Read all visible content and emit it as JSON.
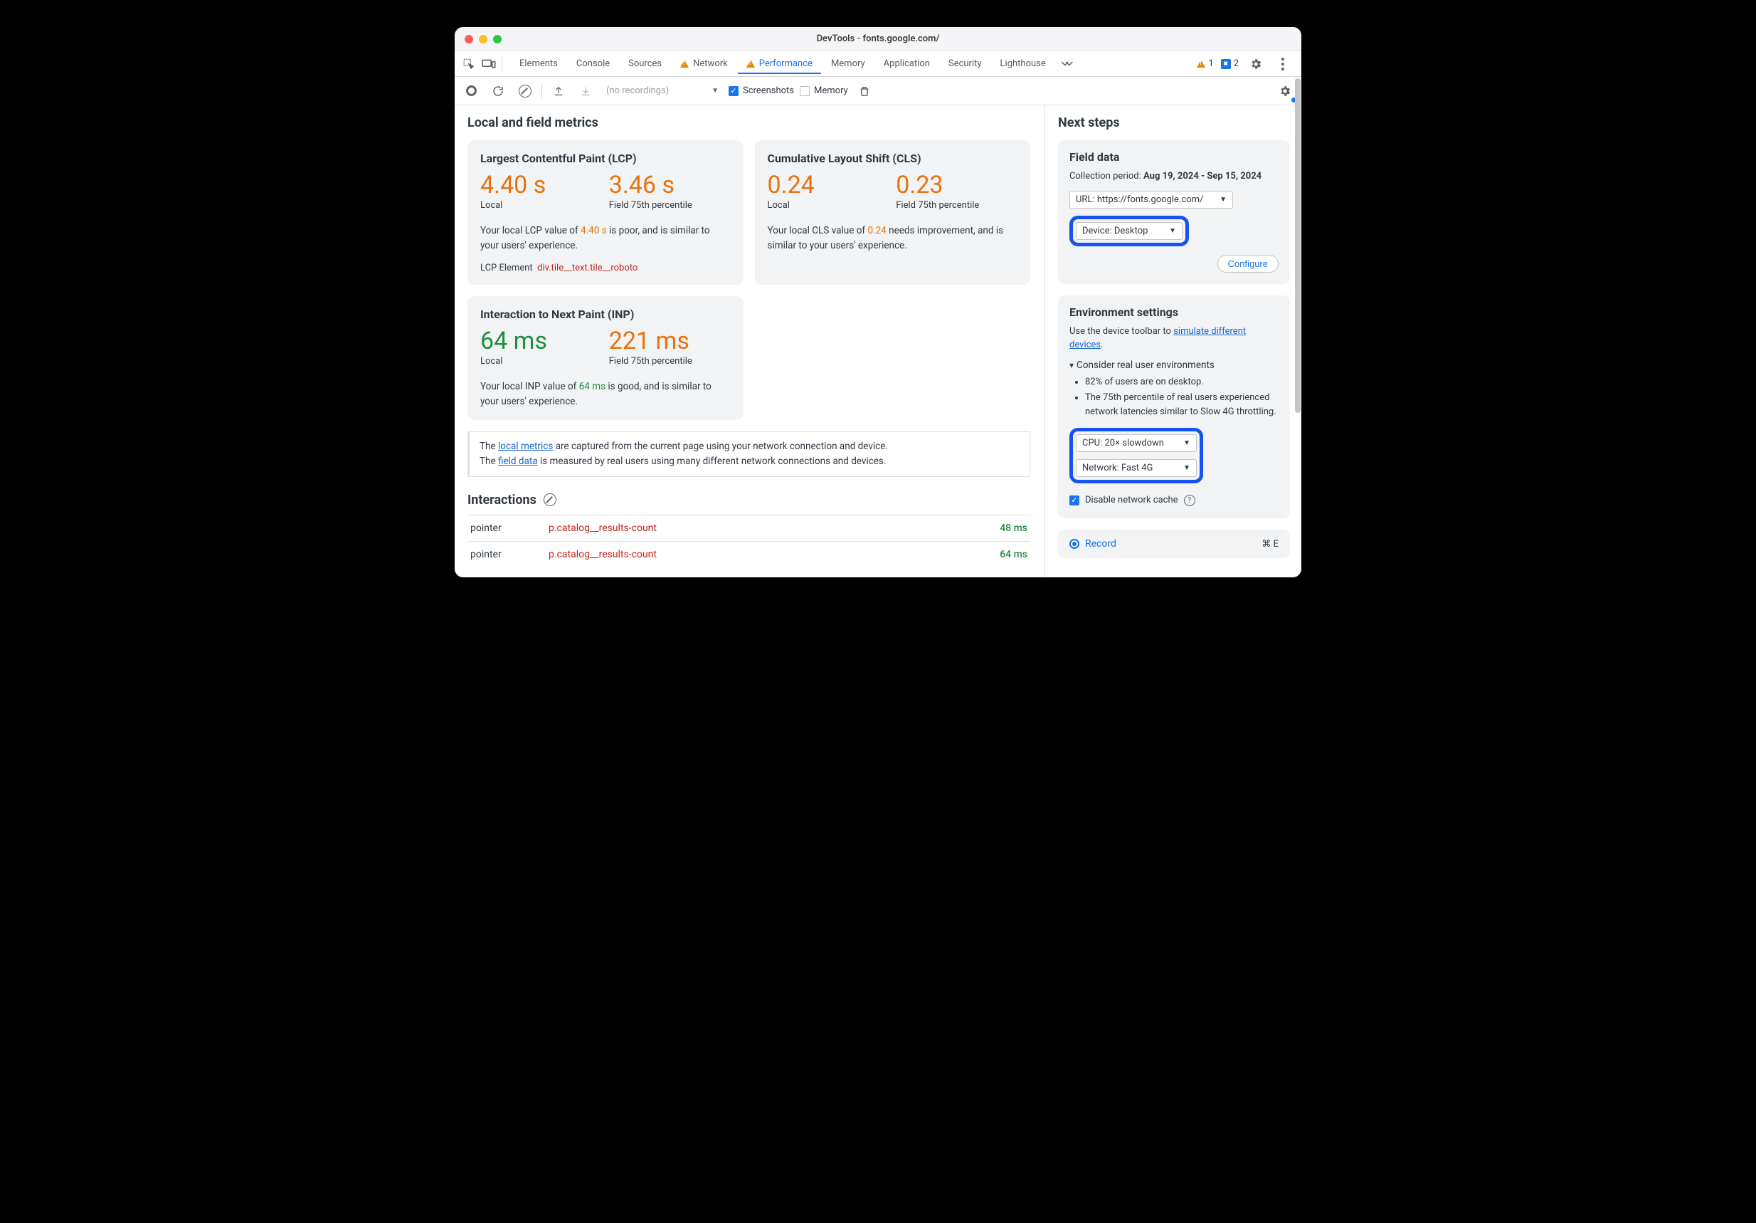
{
  "titlebar": {
    "title": "DevTools - fonts.google.com/"
  },
  "tabs": {
    "items": [
      "Elements",
      "Console",
      "Sources",
      "Network",
      "Performance",
      "Memory",
      "Application",
      "Security",
      "Lighthouse"
    ],
    "active": "Performance",
    "warn_count": "1",
    "msg_count": "2"
  },
  "toolbar": {
    "recordings_placeholder": "(no recordings)",
    "screenshots_label": "Screenshots",
    "memory_label": "Memory"
  },
  "metrics_title": "Local and field metrics",
  "lcp": {
    "title": "Largest Contentful Paint (LCP)",
    "local_val": "4.40 s",
    "local_label": "Local",
    "field_val": "3.46 s",
    "field_label": "Field 75th percentile",
    "note_pre": "Your local LCP value of ",
    "note_val": "4.40 s",
    "note_post": " is poor, and is similar to your users' experience.",
    "el_label": "LCP Element",
    "el_selector": "div.tile__text.tile__roboto"
  },
  "cls": {
    "title": "Cumulative Layout Shift (CLS)",
    "local_val": "0.24",
    "local_label": "Local",
    "field_val": "0.23",
    "field_label": "Field 75th percentile",
    "note_pre": "Your local CLS value of ",
    "note_val": "0.24",
    "note_post": " needs improvement, and is similar to your users' experience."
  },
  "inp": {
    "title": "Interaction to Next Paint (INP)",
    "local_val": "64 ms",
    "local_label": "Local",
    "field_val": "221 ms",
    "field_label": "Field 75th percentile",
    "note_pre": "Your local INP value of ",
    "note_val": "64 ms",
    "note_post": " is good, and is similar to your users' experience."
  },
  "infobox": {
    "line1_pre": "The ",
    "line1_link": "local metrics",
    "line1_post": " are captured from the current page using your network connection and device.",
    "line2_pre": "The ",
    "line2_link": "field data",
    "line2_post": " is measured by real users using many different network connections and devices."
  },
  "interactions": {
    "title": "Interactions",
    "rows": [
      {
        "type": "pointer",
        "selector": "p.catalog__results-count",
        "ms": "48 ms"
      },
      {
        "type": "pointer",
        "selector": "p.catalog__results-count",
        "ms": "64 ms"
      }
    ]
  },
  "next_steps_title": "Next steps",
  "field_data": {
    "title": "Field data",
    "period_label": "Collection period: ",
    "period_value": "Aug 19, 2024 - Sep 15, 2024",
    "url_select": "URL: https://fonts.google.com/",
    "device_select": "Device: Desktop",
    "configure_label": "Configure"
  },
  "env": {
    "title": "Environment settings",
    "hint_pre": "Use the device toolbar to ",
    "hint_link": "simulate different devices",
    "hint_post": ".",
    "details_summary": "Consider real user environments",
    "bullets": [
      "82% of users are on desktop.",
      "The 75th percentile of real users experienced network latencies similar to Slow 4G throttling."
    ],
    "cpu_select": "CPU: 20× slowdown",
    "net_select": "Network: Fast 4G",
    "cache_label": "Disable network cache"
  },
  "record": {
    "label": "Record",
    "shortcut": "⌘ E"
  }
}
